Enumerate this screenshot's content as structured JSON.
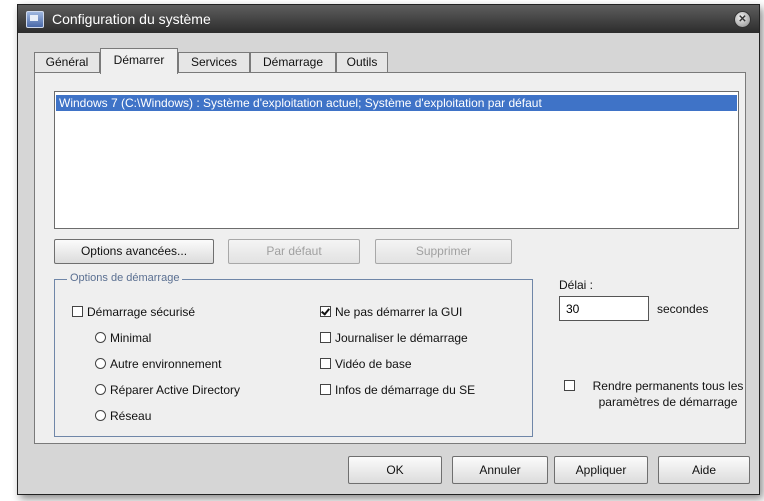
{
  "window": {
    "title": "Configuration du système",
    "icon": "system-config-icon",
    "close_icon": "close-icon"
  },
  "tabs": [
    {
      "label": "Général",
      "active": false
    },
    {
      "label": "Démarrer",
      "active": true
    },
    {
      "label": "Services",
      "active": false
    },
    {
      "label": "Démarrage",
      "active": false
    },
    {
      "label": "Outils",
      "active": false
    }
  ],
  "os_list": {
    "entries": [
      "Windows 7 (C:\\Windows) : Système d'exploitation actuel; Système d'exploitation par défaut"
    ],
    "selected_index": 0
  },
  "list_buttons": {
    "advanced": "Options avancées...",
    "default": "Par défaut",
    "delete": "Supprimer"
  },
  "boot_options": {
    "title": "Options de démarrage",
    "safe_boot": {
      "label": "Démarrage sécurisé",
      "checked": false
    },
    "radios": [
      "Minimal",
      "Autre environnement",
      "Réparer Active Directory",
      "Réseau"
    ],
    "checkboxes": [
      {
        "label": "Ne pas démarrer la GUI",
        "checked": true
      },
      {
        "label": "Journaliser le démarrage",
        "checked": false
      },
      {
        "label": "Vidéo de base",
        "checked": false
      },
      {
        "label": "Infos de démarrage du SE",
        "checked": false
      }
    ]
  },
  "timeout": {
    "label": "Délai :",
    "value": "30",
    "unit": "secondes"
  },
  "permanent": {
    "label": "Rendre permanents tous les paramètres de démarrage",
    "checked": false
  },
  "footer": {
    "ok": "OK",
    "cancel": "Annuler",
    "apply": "Appliquer",
    "help": "Aide"
  }
}
